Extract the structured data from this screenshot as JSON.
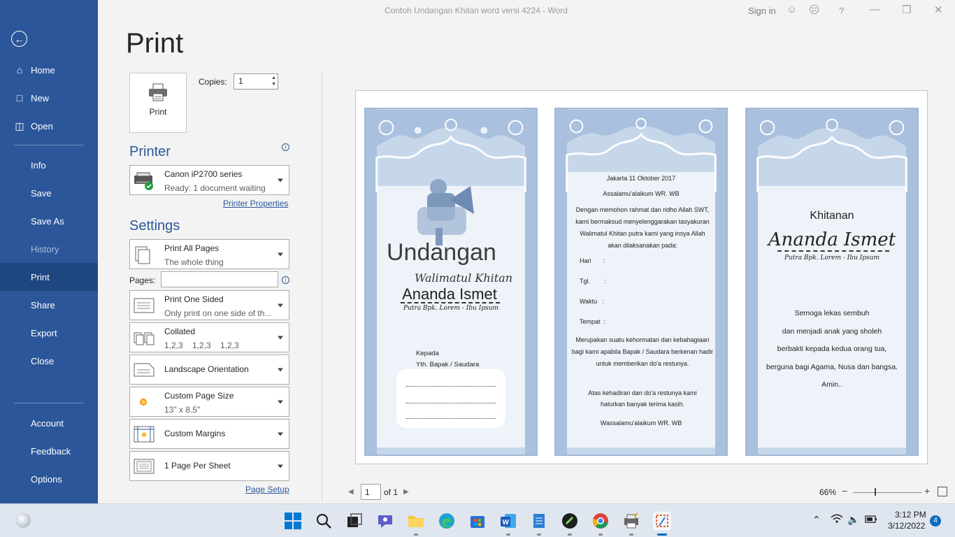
{
  "window": {
    "title": "Contoh Undangan Khitan word versi 4224  -  Word",
    "sign_in": "Sign in",
    "help": "?"
  },
  "nav": {
    "items": [
      {
        "label": "Home"
      },
      {
        "label": "New"
      },
      {
        "label": "Open"
      },
      {
        "label": "Info"
      },
      {
        "label": "Save"
      },
      {
        "label": "Save As"
      },
      {
        "label": "History"
      },
      {
        "label": "Print"
      },
      {
        "label": "Share"
      },
      {
        "label": "Export"
      },
      {
        "label": "Close"
      },
      {
        "label": "Account"
      },
      {
        "label": "Feedback"
      },
      {
        "label": "Options"
      }
    ],
    "active": "Print"
  },
  "print": {
    "title": "Print",
    "button_label": "Print",
    "copies_label": "Copies:",
    "copies_value": "1"
  },
  "printer": {
    "heading": "Printer",
    "name": "Canon iP2700 series",
    "status": "Ready: 1 document waiting",
    "properties_link": "Printer Properties"
  },
  "settings": {
    "heading": "Settings",
    "print_range": {
      "title": "Print All Pages",
      "subtitle": "The whole thing"
    },
    "pages_label": "Pages:",
    "pages_value": "",
    "sides": {
      "title": "Print One Sided",
      "subtitle": "Only print on one side of th..."
    },
    "collation": {
      "title": "Collated",
      "subtitle": "1,2,3    1,2,3    1,2,3"
    },
    "orientation": {
      "title": "Landscape Orientation"
    },
    "paper": {
      "title": "Custom Page Size",
      "subtitle": "13\" x 8.5\""
    },
    "margins": {
      "title": "Custom Margins"
    },
    "per_sheet": {
      "title": "1 Page Per Sheet"
    },
    "page_setup_link": "Page Setup"
  },
  "preview": {
    "panel1": {
      "title": "Undangan",
      "subtitle": "Walimatul Khitan",
      "name": "Ananda Ismet",
      "parents": "Putra Bpk. Lorem - Ibu Ipsum",
      "to": "Kepada",
      "yth": "Yth. Bapak / Saudara"
    },
    "panel2": {
      "date": "Jakarta 11 Oktober 2017",
      "greeting": "Assalamu'alaikum  WR. WB",
      "intro": "Dengan memohon rahmat dan ridho Allah SWT, kami bermaksud menyelenggarakan tasyakuran Walimatul Khitan putra kami yang insya Allah akan dilaksanakan pada:",
      "fields": [
        "Hari       :",
        "Tgl.        :",
        "Waktu   :",
        "Tempat  :"
      ],
      "request": "Merupakan suatu kehormatan dan kebahagiaan bagi kami apabila Bapak / Saudara berkenan hadir untuk memberikan do'a restunya.",
      "thanks": "Atas kehadiran dan do'a restunya kami haturkan banyak terima kasih.",
      "closing": "Wassalamu'alaikum WR. WB"
    },
    "panel3": {
      "title": "Khitanan",
      "name": "Ananda Ismet",
      "parents": "Putra Bpk. Lorem - Ibu Ipsum",
      "wishes": [
        "Semoga lekas sembuh",
        "dan menjadi anak yang sholeh",
        "berbakti kepada kedua  orang tua,",
        "berguna bagi Agama,  Nusa dan bangsa.",
        "Amin.."
      ]
    }
  },
  "footer": {
    "page_value": "1",
    "page_of": "of 1",
    "zoom": "66%",
    "zoom_minus": "−",
    "zoom_plus": "+"
  },
  "taskbar": {
    "time": "3:12 PM",
    "date": "3/12/2022",
    "badge": "4"
  },
  "colors": {
    "nav_bg": "#2b579a",
    "nav_active": "#1e4680",
    "accent": "#2b579a"
  }
}
